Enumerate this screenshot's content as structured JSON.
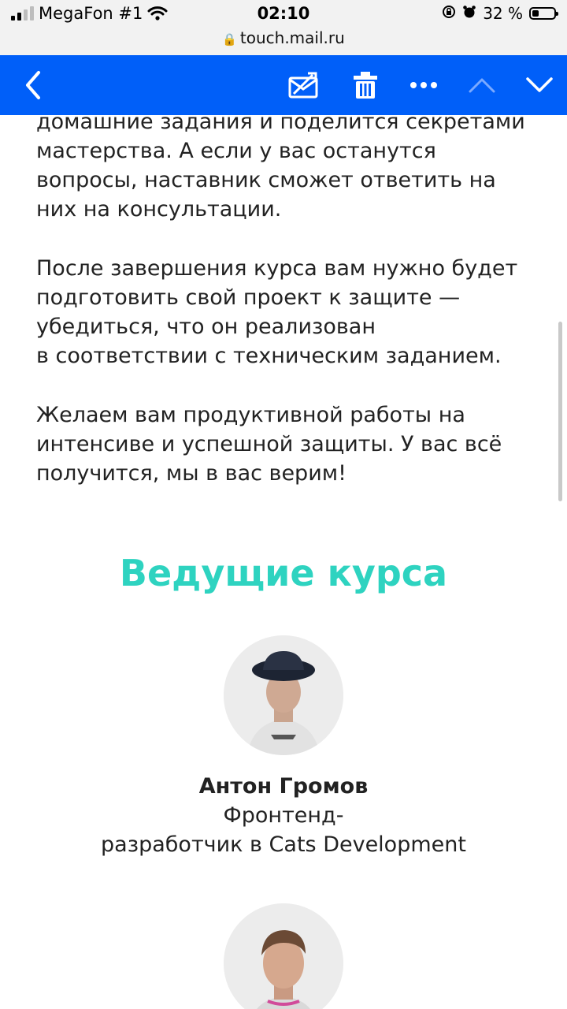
{
  "status_bar": {
    "carrier": "MegaFon #1",
    "time": "02:10",
    "battery": "32 %",
    "url": "touch.mail.ru"
  },
  "toolbar": {
    "icons": [
      "back-chevron-icon",
      "spam-icon",
      "trash-icon",
      "more-icon",
      "chevron-up-icon",
      "chevron-down-icon"
    ],
    "color": "#005ff9"
  },
  "content": {
    "paragraphs": [
      "домашние задания и поделится секретами\nмастерства. А если у вас останутся\nвопросы, наставник сможет ответить на\nних на консультации.",
      "После завершения курса вам нужно будет\nподготовить свой проект к защите —\nубедиться, что он реализован\nв соответствии с техническим заданием.",
      "Желаем вам продуктивной работы на\nинтенсиве и успешной защиты. У вас всё\nполучится, мы в вас верим!"
    ],
    "section_title": "Ведущие курса",
    "accent_color": "#2ed3c0",
    "speakers": [
      {
        "name": "Антон Громов",
        "role": "Фронтенд-\nразработчик в Cats Development"
      }
    ]
  }
}
